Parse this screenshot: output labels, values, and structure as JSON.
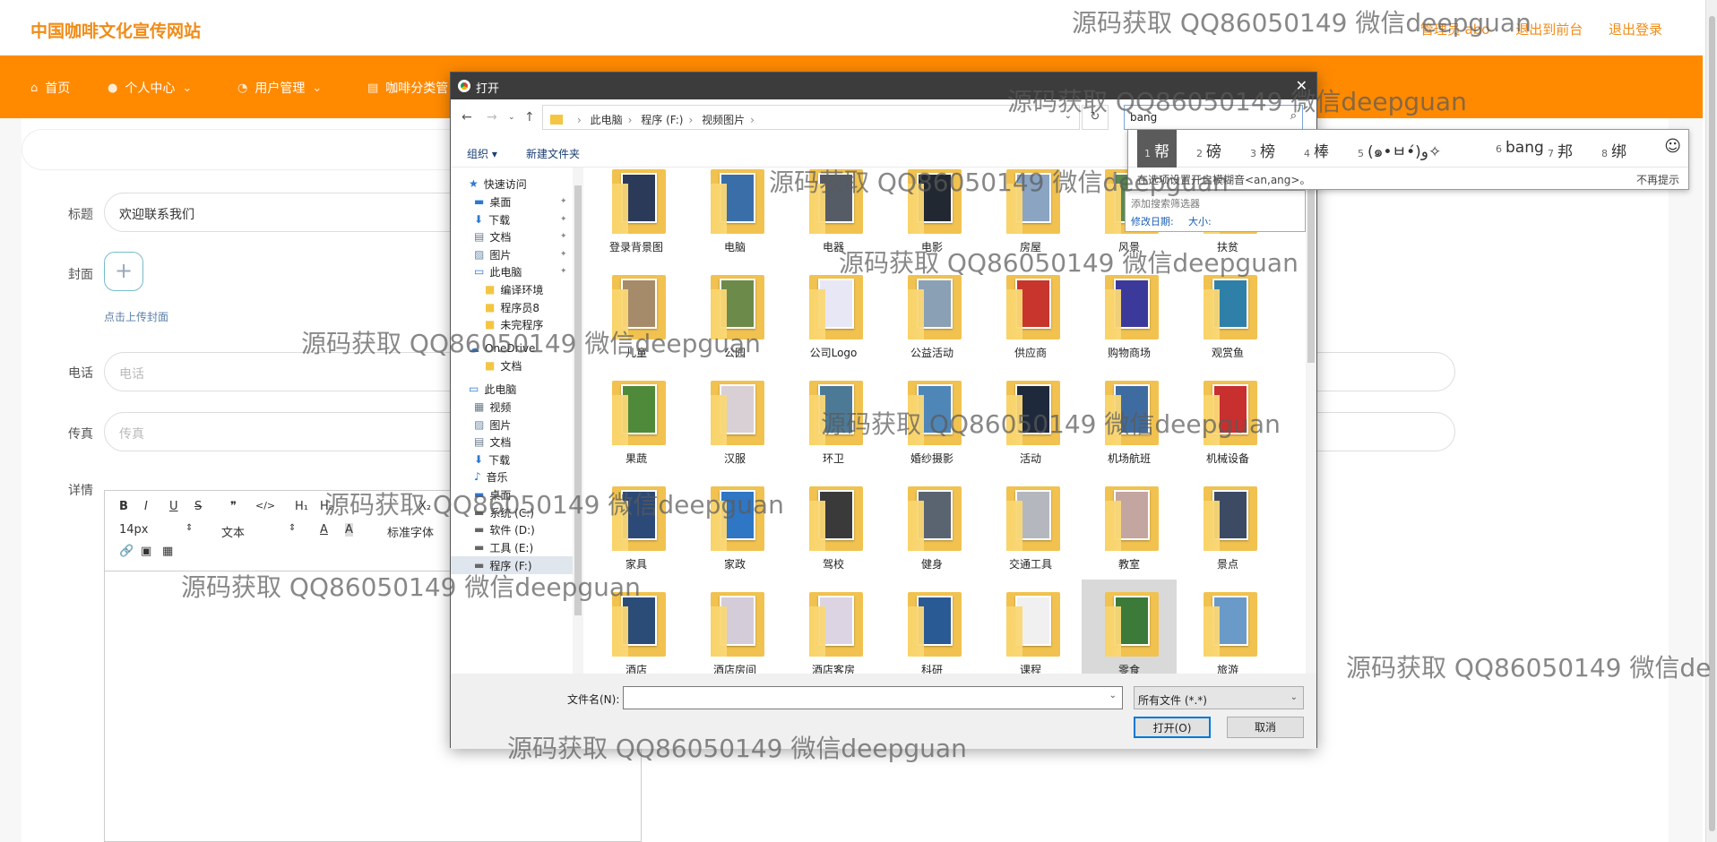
{
  "site": {
    "logo": "中国咖啡文化宣传网站",
    "user": "管理员 abo",
    "back": "退出到前台",
    "logout": "退出登录"
  },
  "nav": [
    {
      "label": "首页",
      "icon": "home-icon"
    },
    {
      "label": "个人中心",
      "icon": "user-icon"
    },
    {
      "label": "用户管理",
      "icon": "users-icon"
    },
    {
      "label": "咖啡分类管",
      "icon": "list-icon"
    }
  ],
  "form": {
    "title_label": "标题",
    "title_value": "欢迎联系我们",
    "cover_label": "封面",
    "cover_hint": "点击上传封面",
    "upload_plus": "+",
    "phone_label": "电话",
    "phone_ph": "电话",
    "fax_label": "传真",
    "fax_ph": "传真",
    "detail_label": "详情"
  },
  "editor": {
    "bold": "B",
    "italic": "I",
    "underline": "U",
    "strike": "S",
    "quote": "❞",
    "code": "</>",
    "h1": "H₁",
    "h2": "H₂",
    "font_size": "14px",
    "font_type": "文本",
    "font_color": "A",
    "bg_color": "A",
    "font_family": "标准字体",
    "sub": "X₂"
  },
  "dialog": {
    "title": "打开",
    "path": [
      "此电脑",
      "程序 (F:)",
      "视频图片"
    ],
    "search": "bang",
    "organize": "组织 ▾",
    "newfolder": "新建文件夹",
    "tree": [
      {
        "label": "快速访问",
        "icon": "star-icon",
        "pin": false
      },
      {
        "label": "桌面",
        "icon": "desktop-icon",
        "pin": true
      },
      {
        "label": "下载",
        "icon": "download-icon",
        "pin": true
      },
      {
        "label": "文档",
        "icon": "document-icon",
        "pin": true
      },
      {
        "label": "图片",
        "icon": "picture-icon",
        "pin": true
      },
      {
        "label": "此电脑",
        "icon": "computer-icon",
        "pin": true
      },
      {
        "label": "编译环境",
        "icon": "folder-icon",
        "pin": false
      },
      {
        "label": "程序员8",
        "icon": "folder-icon",
        "pin": false
      },
      {
        "label": "未完程序",
        "icon": "folder-icon",
        "pin": false
      },
      {
        "label": "OneDrive",
        "icon": "cloud-icon",
        "pin": false
      },
      {
        "label": "文档",
        "icon": "folder-icon",
        "pin": false
      },
      {
        "label": "此电脑",
        "icon": "computer-icon",
        "pin": false
      },
      {
        "label": "视频",
        "icon": "video-icon",
        "pin": false
      },
      {
        "label": "图片",
        "icon": "picture-icon",
        "pin": false
      },
      {
        "label": "文档",
        "icon": "document-icon",
        "pin": false
      },
      {
        "label": "下载",
        "icon": "download-icon",
        "pin": false
      },
      {
        "label": "音乐",
        "icon": "music-icon",
        "pin": false
      },
      {
        "label": "桌面",
        "icon": "desktop-icon",
        "pin": false
      },
      {
        "label": "系统 (C:)",
        "icon": "drive-icon",
        "pin": false
      },
      {
        "label": "软件 (D:)",
        "icon": "drive-icon",
        "pin": false
      },
      {
        "label": "工具 (E:)",
        "icon": "drive-icon",
        "pin": false
      },
      {
        "label": "程序 (F:)",
        "icon": "drive-icon",
        "pin": false,
        "selected": true
      }
    ],
    "folders": [
      {
        "name": "登录背景图",
        "color": "#2a3a58"
      },
      {
        "name": "电脑",
        "color": "#3a6ea8"
      },
      {
        "name": "电器",
        "color": "#555c66"
      },
      {
        "name": "电影",
        "color": "#222831"
      },
      {
        "name": "房屋",
        "color": "#8aa4c2"
      },
      {
        "name": "风景",
        "color": "#5a8a50"
      },
      {
        "name": "扶贫",
        "color": "#b08a50"
      },
      {
        "name": "儿童",
        "color": "#a68b6a"
      },
      {
        "name": "公园",
        "color": "#6c8a4a"
      },
      {
        "name": "公司Logo",
        "color": "#e7e7f5"
      },
      {
        "name": "公益活动",
        "color": "#8aa0b4"
      },
      {
        "name": "供应商",
        "color": "#c8352c"
      },
      {
        "name": "购物商场",
        "color": "#3b3a9a"
      },
      {
        "name": "观赏鱼",
        "color": "#2f80a8"
      },
      {
        "name": "果蔬",
        "color": "#4f8a3a"
      },
      {
        "name": "汉服",
        "color": "#d8d0d4"
      },
      {
        "name": "环卫",
        "color": "#4c7a96"
      },
      {
        "name": "婚纱摄影",
        "color": "#4f86b8"
      },
      {
        "name": "活动",
        "color": "#1e2a3c"
      },
      {
        "name": "机场航班",
        "color": "#3f6ca0"
      },
      {
        "name": "机械设备",
        "color": "#c82f2f"
      },
      {
        "name": "家具",
        "color": "#2c4a78"
      },
      {
        "name": "家政",
        "color": "#2f76c4"
      },
      {
        "name": "驾校",
        "color": "#3a3a3a"
      },
      {
        "name": "健身",
        "color": "#5a6470"
      },
      {
        "name": "交通工具",
        "color": "#b4b8be"
      },
      {
        "name": "教室",
        "color": "#c4a6a0"
      },
      {
        "name": "景点",
        "color": "#3c4a64"
      },
      {
        "name": "酒店",
        "color": "#2a4c76"
      },
      {
        "name": "酒店房间",
        "color": "#d4ccd8"
      },
      {
        "name": "酒店客房",
        "color": "#dcd4e2"
      },
      {
        "name": "科研",
        "color": "#2a5a94"
      },
      {
        "name": "课程",
        "color": "#f0f0f0"
      },
      {
        "name": "零食",
        "color": "#3c7a3a",
        "selected": true
      },
      {
        "name": "旅游",
        "color": "#6a9ac8"
      }
    ],
    "filename_label": "文件名(N):",
    "filetype": "所有文件 (*.*)",
    "open": "打开(O)",
    "cancel": "取消"
  },
  "searchpop": {
    "add": "添加搜索筛选器",
    "date": "修改日期:",
    "size": "大小:"
  },
  "ime": {
    "candidates": [
      {
        "n": "1",
        "t": "帮"
      },
      {
        "n": "2",
        "t": "磅"
      },
      {
        "n": "3",
        "t": "榜"
      },
      {
        "n": "4",
        "t": "棒"
      },
      {
        "n": "5",
        "t": "(๑•ㅂ•́)و✧"
      },
      {
        "n": "6",
        "t": "bang"
      },
      {
        "n": "7",
        "t": "邦"
      },
      {
        "n": "8",
        "t": "绑"
      }
    ],
    "hint": "在选项设置开启模糊音<an,ang>。",
    "dismiss": "不再提示"
  },
  "watermarks": [
    "源码获取 QQ86050149 微信deepguan",
    "源码获取 QQ86050149 微信deepguan",
    "源码获取 QQ86050149 微信deepguan",
    "源码获取 QQ86050149 微信deepguan",
    "源码获取 QQ86050149 微信deepguan",
    "源码获取 QQ86050149 微信deepguan",
    "源码获取 QQ86050149 微信deepguan",
    "源码获取 QQ86050149 微信deepguan",
    "源码获取 QQ86050149 微信deepguan",
    "源码获取 QQ86050149 微信deepguan",
    "源码获取 QQ86050149 微信de"
  ]
}
